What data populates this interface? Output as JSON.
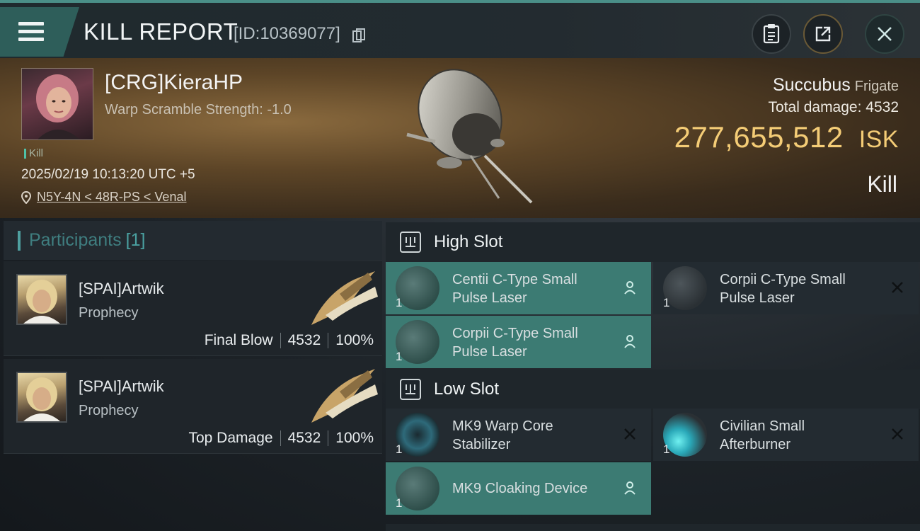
{
  "header": {
    "title": "KILL REPORT",
    "report_id": "[ID:10369077]",
    "menu_icon": "hamburger-menu-icon",
    "buttons": [
      "clipboard-icon",
      "share-icon",
      "close-icon"
    ]
  },
  "victim": {
    "name": "[CRG]KieraHP",
    "warp_scramble": "Warp Scramble Strength: -1.0",
    "tag": "Kill",
    "timestamp": "2025/02/19 10:13:20 UTC +5",
    "location": "N5Y-4N < 48R-PS < Venal",
    "ship_name": "Succubus",
    "ship_class": "Frigate",
    "total_damage_label": "Total damage:",
    "total_damage": "4532",
    "isk_value": "277,655,512",
    "isk_unit": "ISK",
    "outcome": "Kill"
  },
  "participants": {
    "title": "Participants",
    "count": "[1]",
    "rows": [
      {
        "name": "[SPAI]Artwik",
        "ship": "Prophecy",
        "role": "Final Blow",
        "damage": "4532",
        "percent": "100%"
      },
      {
        "name": "[SPAI]Artwik",
        "ship": "Prophecy",
        "role": "Top Damage",
        "damage": "4532",
        "percent": "100%"
      }
    ]
  },
  "fitting": {
    "high_slot_label": "High Slot",
    "low_slot_label": "Low Slot",
    "high_slot": [
      {
        "name": "Centii C-Type Small Pulse Laser",
        "qty": "1",
        "status": "person-icon"
      },
      {
        "name": "Corpii C-Type Small Pulse Laser",
        "qty": "1",
        "status": "x-icon"
      },
      {
        "name": "Corpii C-Type Small Pulse Laser",
        "qty": "1",
        "status": "person-icon"
      }
    ],
    "low_slot": [
      {
        "name": "MK9 Warp Core Stabilizer",
        "qty": "1",
        "status": "x-icon"
      },
      {
        "name": "Civilian Small Afterburner",
        "qty": "1",
        "status": "x-icon"
      },
      {
        "name": "MK9 Cloaking Device",
        "qty": "1",
        "status": "person-icon"
      }
    ]
  },
  "colors": {
    "accent_teal": "#3c7b73",
    "isk_gold": "#f4cc76"
  }
}
